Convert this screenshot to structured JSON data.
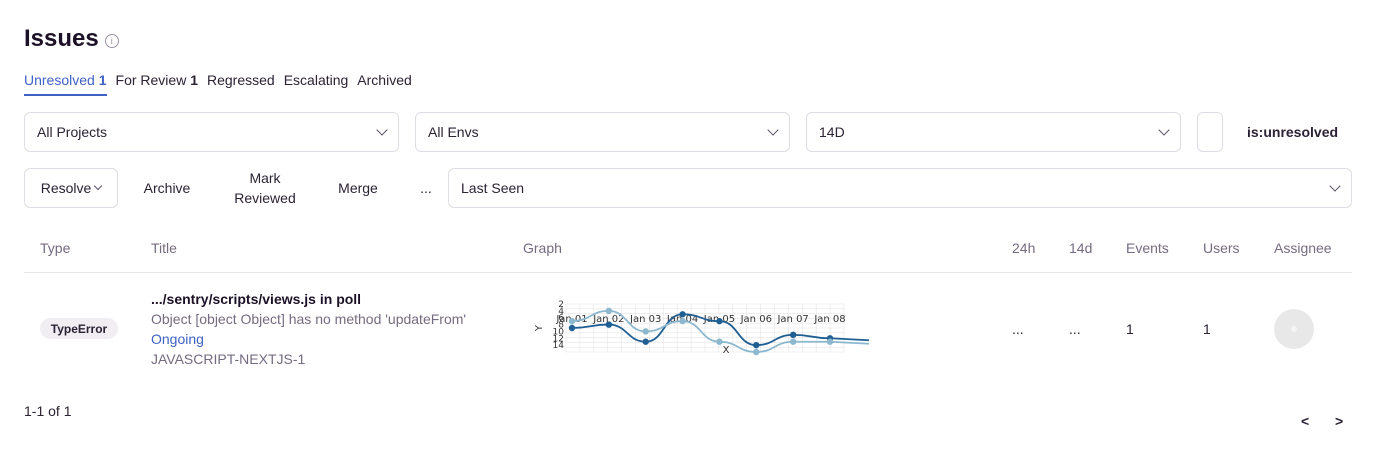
{
  "header": {
    "title": "Issues",
    "info_icon": "info-icon"
  },
  "tabs": [
    {
      "label": "Unresolved",
      "count": "1",
      "active": true
    },
    {
      "label": "For Review",
      "count": "1"
    },
    {
      "label": "Regressed",
      "count": ""
    },
    {
      "label": "Escalating",
      "count": ""
    },
    {
      "label": "Archived",
      "count": ""
    }
  ],
  "filters": {
    "projects": "All Projects",
    "envs": "All Envs",
    "period": "14D",
    "query": "is:unresolved"
  },
  "actions": {
    "resolve": "Resolve",
    "archive": "Archive",
    "mark_reviewed_1": "Mark",
    "mark_reviewed_2": "Reviewed",
    "merge": "Merge",
    "more": "...",
    "sort": "Last Seen"
  },
  "columns": {
    "type": "Type",
    "title": "Title",
    "graph": "Graph",
    "h24": "24h",
    "d14": "14d",
    "events": "Events",
    "users": "Users",
    "assignee": "Assignee"
  },
  "issue": {
    "type": "TypeError",
    "culprit": ".../sentry/scripts/views.js in poll",
    "message": "Object [object Object] has no method 'updateFrom'",
    "status": "Ongoing",
    "short_id": "JAVASCRIPT-NEXTJS-1",
    "h24": "...",
    "d14": "...",
    "events": "1",
    "users": "1"
  },
  "chart_data": {
    "type": "line",
    "x_ticks": [
      "Jan 01",
      "Jan 02",
      "Jan 03",
      "Jan 04",
      "Jan 05",
      "Jan 06",
      "Jan 07",
      "Jan 08"
    ],
    "y_ticks": [
      "2",
      "4",
      "6",
      "8",
      "10",
      "12",
      "14"
    ],
    "xlabel": "X",
    "ylabel": "Y",
    "series": [
      {
        "color": "#1f5f94",
        "values": [
          9,
          8,
          13,
          5,
          7,
          14,
          11,
          12
        ]
      },
      {
        "color": "#8cb8cf",
        "values": [
          7,
          4,
          10,
          7,
          13,
          16,
          13,
          13
        ]
      }
    ]
  },
  "pagination": {
    "summary": "1-1 of 1",
    "prev": "<",
    "next": ">"
  }
}
